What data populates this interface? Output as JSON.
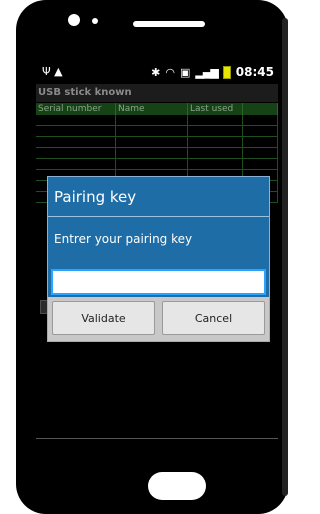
{
  "status_bar": {
    "time": "08:45",
    "icons": [
      "usb-icon",
      "warning-icon",
      "bluetooth-icon",
      "wifi-icon",
      "sdcard-icon",
      "signal-icon",
      "battery-icon"
    ]
  },
  "app": {
    "title": "USB stick known",
    "table": {
      "columns": [
        "Serial number",
        "Name",
        "Last used",
        ""
      ],
      "rows": [
        [
          "",
          "",
          "",
          ""
        ],
        [
          "",
          "",
          "",
          ""
        ],
        [
          "",
          "",
          "",
          ""
        ],
        [
          "",
          "",
          "",
          ""
        ],
        [
          "",
          "",
          "",
          ""
        ],
        [
          "",
          "",
          "",
          ""
        ],
        [
          "",
          "",
          "",
          ""
        ],
        [
          "",
          "",
          "",
          ""
        ]
      ]
    }
  },
  "dialog": {
    "title": "Pairing key",
    "message": "Entrer your pairing key",
    "input_value": "",
    "validate_label": "Validate",
    "cancel_label": "Cancel"
  },
  "colors": {
    "dialog_bg": "#1f6da6",
    "table_header_bg": "#1c5a1c",
    "input_focus": "#2aa4ff"
  }
}
